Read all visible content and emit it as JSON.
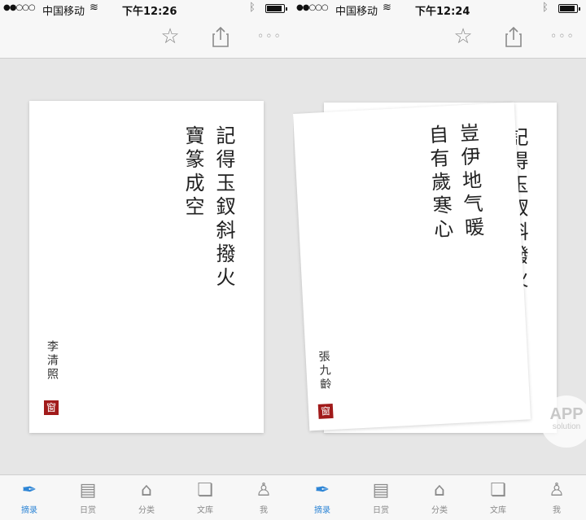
{
  "left_screen": {
    "status": {
      "signal": "●●○○○",
      "carrier": "中国移动",
      "time": "下午12:26"
    },
    "poem": {
      "line1": "記得玉釵斜撥火",
      "line2": "寶篆成空",
      "author": "李清照",
      "seal": "窗"
    }
  },
  "right_screen": {
    "status": {
      "signal": "●●○○○",
      "carrier": "中国移动",
      "time": "下午12:24"
    },
    "back_card": {
      "line1": "記得玉釵斜撥火"
    },
    "front_card": {
      "line1": "豈伊地气暖",
      "line2": "自有歲寒心",
      "author": "張九齡",
      "seal": "窗"
    }
  },
  "tabs": [
    {
      "label": "摘录",
      "icon": "pen-nib-icon"
    },
    {
      "label": "日赏",
      "icon": "calendar-icon"
    },
    {
      "label": "分类",
      "icon": "tag-icon"
    },
    {
      "label": "文库",
      "icon": "books-icon"
    },
    {
      "label": "我",
      "icon": "person-icon"
    }
  ],
  "toolbar": {
    "star": "☆",
    "more": "◦◦◦"
  },
  "watermark": {
    "line1": "APP",
    "line2": "solution"
  },
  "colors": {
    "active_tab": "#2f86d6",
    "seal": "#a11a1a"
  }
}
